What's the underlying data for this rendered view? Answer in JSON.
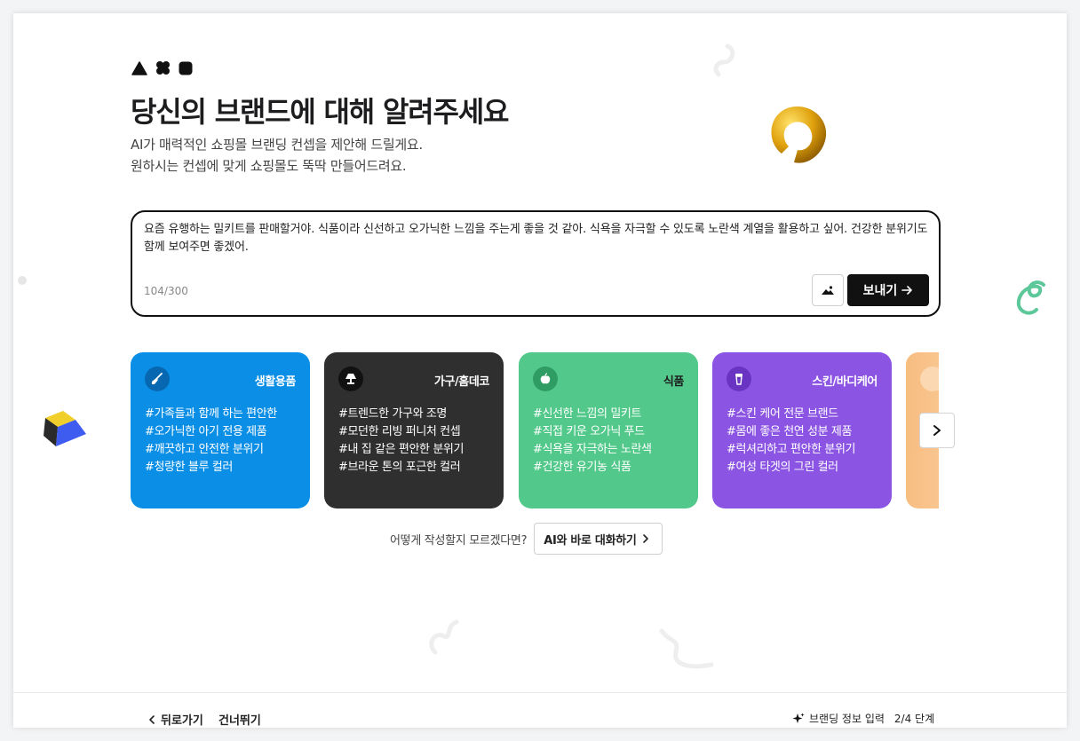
{
  "header": {
    "title": "당신의 브랜드에 대해 알려주세요",
    "subtitle_line1": "AI가 매력적인 쇼핑몰 브랜딩 컨셉을 제안해 드릴게요.",
    "subtitle_line2": "원하시는 컨셉에 맞게 쇼핑몰도 뚝딱 만들어드려요."
  },
  "input": {
    "value": "요즘 유행하는 밀키트를 판매할거야. 식품이라 신선하고 오가닉한 느낌을 주는게 좋을 것 같아. 식욕을 자극할 수 있도록 노란색 계열을 활용하고 싶어. 건강한 분위기도 함께 보여주면 좋겠어.",
    "counter": "104/300",
    "image_button_icon": "image-icon",
    "send_label": "보내기"
  },
  "cards": [
    {
      "title": "생활용품",
      "icon": "broom-icon",
      "color": "#0b8fe6",
      "tags": [
        "#가족들과 함께 하는 편안한",
        "#오가닉한 아기 전용 제품",
        "#깨끗하고 안전한 분위기",
        "#청량한 블루 컬러"
      ]
    },
    {
      "title": "가구/홈데코",
      "icon": "lamp-icon",
      "color": "#2f2f2f",
      "tags": [
        "#트렌드한 가구와 조명",
        "#모던한 리빙 퍼니처 컨셉",
        "#내 집 같은 편안한 분위기",
        "#브라운 톤의 포근한 컬러"
      ]
    },
    {
      "title": "식품",
      "icon": "apple-icon",
      "color": "#52c98a",
      "tags": [
        "#신선한 느낌의 밀키트",
        "#직접 키운 오가닉 푸드",
        "#식욕을 자극하는 노란색",
        "#건강한 유기농 식품"
      ]
    },
    {
      "title": "스킨/바디케어",
      "icon": "cosmetic-icon",
      "color": "#8b54e3",
      "tags": [
        "#스킨 케어 전문 브랜드",
        "#몸에 좋은 천연 성분 제품",
        "#럭셔리하고 편안한 분위기",
        "#여성 타겟의 그린 컬러"
      ]
    }
  ],
  "help": {
    "text": "어떻게 작성할지 모르겠다면?",
    "button_label": "AI와 바로 대화하기"
  },
  "footer": {
    "back_label": "뒤로가기",
    "skip_label": "건너뛰기",
    "step_label": "브랜딩 정보 입력",
    "step_count": "2/4 단계"
  },
  "colors": {
    "accent": "#111111",
    "partial_card": "#f6b26b"
  }
}
